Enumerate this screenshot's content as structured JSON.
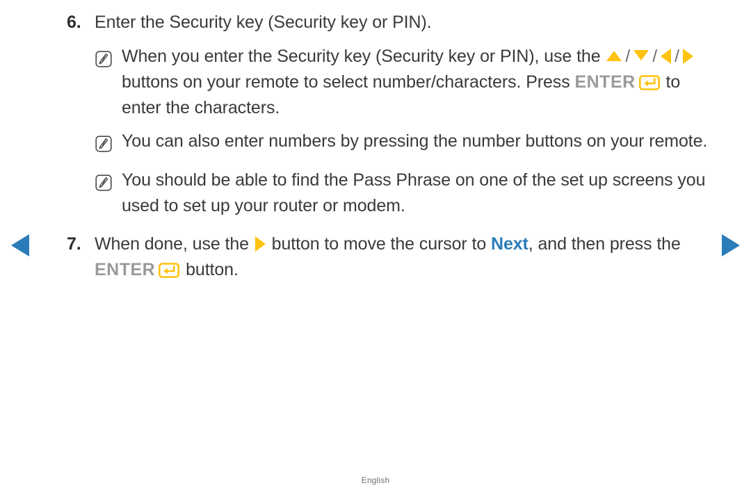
{
  "nav": {
    "prev_label": "Previous page",
    "next_label": "Next page",
    "prev_icon": "triangle-left-icon",
    "next_icon": "triangle-right-icon",
    "arrow_color": "#2b7cb9"
  },
  "colors": {
    "accent_yellow": "#ffc20e",
    "accent_blue": "#2b7cb9",
    "body_text": "#3a3a3a",
    "enter_keyword": "#9a9a9a",
    "footer_text": "#6f6f6f"
  },
  "steps": [
    {
      "number": "6.",
      "text": "Enter the Security key (Security key or PIN).",
      "notes": [
        {
          "icon": "note-pencil-icon",
          "segments": [
            {
              "type": "text",
              "value": "When you enter the Security key (Security key or PIN), use the "
            },
            {
              "type": "triangle-up",
              "value": "▲"
            },
            {
              "type": "separator",
              "value": "/"
            },
            {
              "type": "triangle-down",
              "value": "▼"
            },
            {
              "type": "separator",
              "value": "/"
            },
            {
              "type": "triangle-left",
              "value": "◀"
            },
            {
              "type": "separator",
              "value": "/"
            },
            {
              "type": "triangle-right",
              "value": "▶"
            },
            {
              "type": "text",
              "value": " buttons on your remote to select number/characters. Press "
            },
            {
              "type": "keyword-enter",
              "value": "ENTER"
            },
            {
              "type": "enter-icon",
              "value": "enter-key-icon"
            },
            {
              "type": "text",
              "value": " to enter the characters."
            }
          ]
        },
        {
          "icon": "note-pencil-icon",
          "segments": [
            {
              "type": "text",
              "value": "You can also enter numbers by pressing the number buttons on your remote."
            }
          ]
        },
        {
          "icon": "note-pencil-icon",
          "segments": [
            {
              "type": "text",
              "value": "You should be able to find the Pass Phrase on one of the set up screens you used to set up your router or modem."
            }
          ]
        }
      ]
    },
    {
      "number": "7.",
      "notes": [],
      "segments": [
        {
          "type": "text",
          "value": "When done, use the "
        },
        {
          "type": "triangle-right",
          "value": "▶"
        },
        {
          "type": "text",
          "value": " button to move the cursor to "
        },
        {
          "type": "keyword-next",
          "value": "Next"
        },
        {
          "type": "text",
          "value": ", and then press the "
        },
        {
          "type": "keyword-enter",
          "value": "ENTER"
        },
        {
          "type": "enter-icon",
          "value": "enter-key-icon"
        },
        {
          "type": "text",
          "value": " button."
        }
      ]
    }
  ],
  "footer": {
    "language": "English"
  }
}
